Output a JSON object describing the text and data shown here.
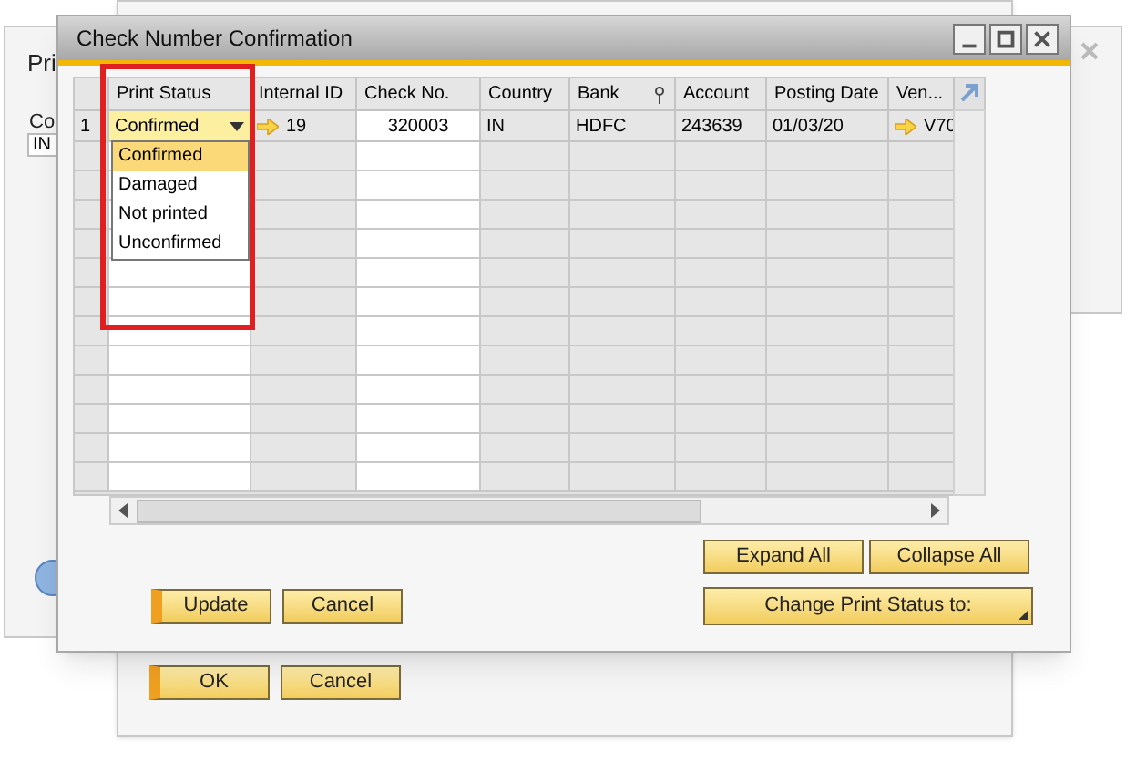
{
  "background_windows": {
    "left": {
      "title": "Pri",
      "field_label": "Co",
      "field_value": "IN"
    },
    "lower": {
      "buttons": [
        {
          "label": "OK",
          "primary": true
        },
        {
          "label": "Cancel",
          "primary": false
        }
      ]
    }
  },
  "dialog": {
    "title": "Check Number Confirmation",
    "table": {
      "columns": [
        {
          "editable": false
        },
        {
          "label": "Print Status",
          "editable": true
        },
        {
          "label": "Internal ID",
          "editable": false
        },
        {
          "label": "Check No.",
          "editable": true
        },
        {
          "label": "Country",
          "editable": false
        },
        {
          "label": "Bank",
          "editable": false
        },
        {
          "label": "Account",
          "editable": false
        },
        {
          "label": "Posting Date",
          "editable": false
        },
        {
          "label": "Ven...",
          "editable": false
        }
      ],
      "rows": [
        {
          "cells": [
            {
              "kind": "text",
              "value": "1"
            },
            {
              "kind": "dropdown",
              "value": "Confirmed"
            },
            {
              "kind": "link",
              "value": "19"
            },
            {
              "kind": "center",
              "value": "320003"
            },
            {
              "kind": "text",
              "value": "IN"
            },
            {
              "kind": "text",
              "value": "HDFC"
            },
            {
              "kind": "text",
              "value": "243639"
            },
            {
              "kind": "text",
              "value": "01/03/20"
            },
            {
              "kind": "link",
              "value": "V70"
            }
          ]
        }
      ]
    },
    "dropdown_options": [
      {
        "label": "Confirmed",
        "selected": true
      },
      {
        "label": "Damaged",
        "selected": false
      },
      {
        "label": "Not printed",
        "selected": false
      },
      {
        "label": "Unconfirmed",
        "selected": false
      }
    ],
    "left_buttons": [
      {
        "label": "Update",
        "primary": true
      },
      {
        "label": "Cancel",
        "primary": false
      }
    ],
    "right_buttons": [
      {
        "label": "Expand All"
      },
      {
        "label": "Collapse All"
      }
    ],
    "menu_button": {
      "label": "Change Print Status to:"
    }
  }
}
